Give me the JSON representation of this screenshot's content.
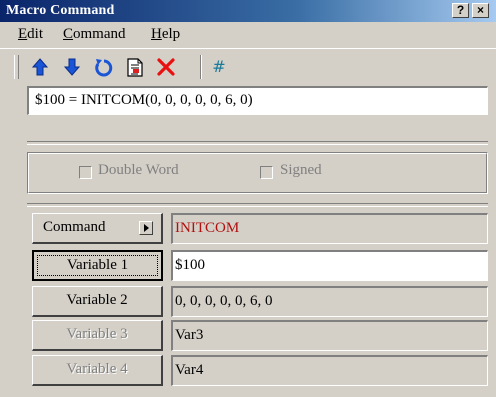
{
  "window": {
    "title": "Macro Command",
    "help_btn": "?",
    "close_btn": "×"
  },
  "menu": {
    "edit": "Edit",
    "command": "Command",
    "help": "Help",
    "edit_key": "E",
    "edit_rest": "dit",
    "command_key": "C",
    "command_rest": "ommand",
    "help_key": "H",
    "help_rest": "elp"
  },
  "toolbar": {
    "icons": [
      "move-up-icon",
      "move-down-icon",
      "undo-icon",
      "insert-file-icon",
      "delete-icon",
      "hash-icon"
    ],
    "hash_label": "#"
  },
  "expression": {
    "value": "$100 = INITCOM(0, 0, 0, 0, 0, 6, 0)"
  },
  "options": {
    "double_word": "Double Word",
    "signed": "Signed"
  },
  "rows": {
    "command": {
      "label": "Command",
      "value": "INITCOM"
    },
    "variable1": {
      "label": "Variable 1",
      "value": "$100"
    },
    "variable2": {
      "label": "Variable 2",
      "value": "0, 0, 0, 0, 0, 6, 0"
    },
    "variable3": {
      "label": "Variable 3",
      "value": "Var3"
    },
    "variable4": {
      "label": "Variable 4",
      "value": "Var4"
    }
  },
  "colors": {
    "titlebar": "#0a246a",
    "command_value": "#b01010",
    "face": "#d4d0c8"
  }
}
